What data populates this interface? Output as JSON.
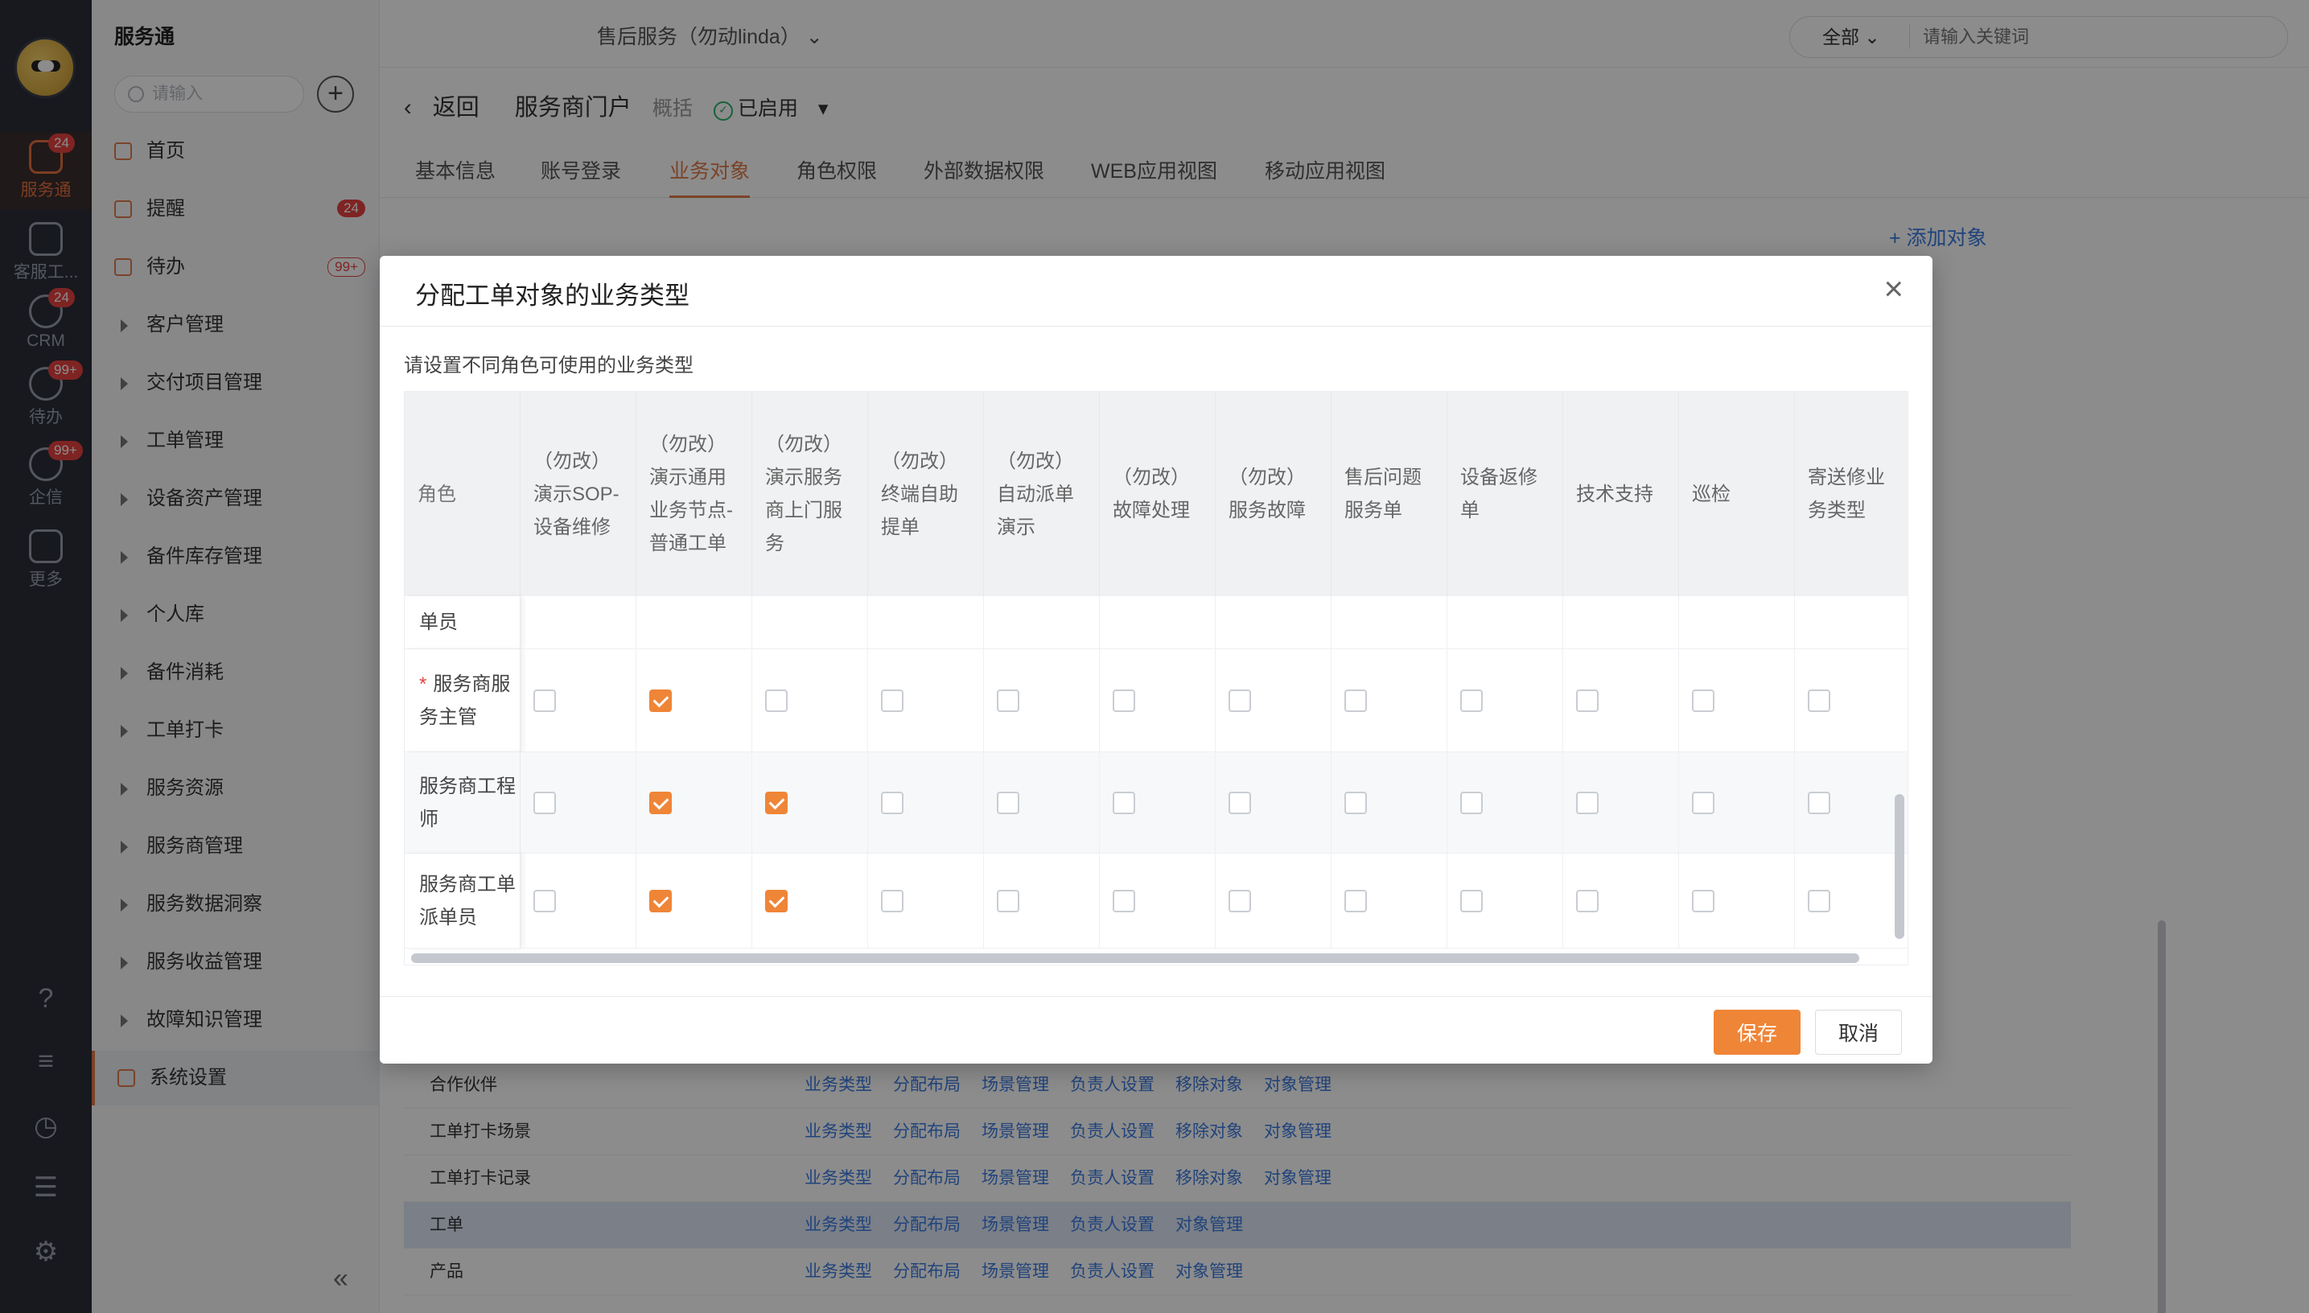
{
  "rail": {
    "items": [
      {
        "label": "服务通",
        "badge": "24"
      },
      {
        "label": "客服工...",
        "badge": ""
      },
      {
        "label": "CRM",
        "badge": "24"
      },
      {
        "label": "待办",
        "badge": "99+"
      },
      {
        "label": "企信",
        "badge": "99+"
      },
      {
        "label": "更多",
        "badge": ""
      }
    ],
    "bottom_icons": [
      "help-icon",
      "notes-icon",
      "clock-icon",
      "user-list-icon",
      "gear-icon"
    ]
  },
  "sidebar": {
    "brand": "服务通",
    "search_placeholder": "请输入",
    "items": [
      {
        "label": "首页",
        "badge": ""
      },
      {
        "label": "提醒",
        "badge": "24"
      },
      {
        "label": "待办",
        "badge": "99+"
      },
      {
        "label": "客户管理",
        "badge": ""
      },
      {
        "label": "交付项目管理",
        "badge": ""
      },
      {
        "label": "工单管理",
        "badge": ""
      },
      {
        "label": "设备资产管理",
        "badge": ""
      },
      {
        "label": "备件库存管理",
        "badge": ""
      },
      {
        "label": "个人库",
        "badge": ""
      },
      {
        "label": "备件消耗",
        "badge": ""
      },
      {
        "label": "工单打卡",
        "badge": ""
      },
      {
        "label": "服务资源",
        "badge": ""
      },
      {
        "label": "服务商管理",
        "badge": ""
      },
      {
        "label": "服务数据洞察",
        "badge": ""
      },
      {
        "label": "服务收益管理",
        "badge": ""
      },
      {
        "label": "故障知识管理",
        "badge": ""
      },
      {
        "label": "系统设置",
        "badge": ""
      }
    ],
    "collapse_label": "«"
  },
  "topbar": {
    "tenant": "售后服务（勿动linda）",
    "search_scope": "全部",
    "search_placeholder": "请输入关键词"
  },
  "page": {
    "back_label": "返回",
    "title": "服务商门户",
    "subtitle": "概括",
    "status": "已启用",
    "tabs": [
      "基本信息",
      "账号登录",
      "业务对象",
      "角色权限",
      "外部数据权限",
      "WEB应用视图",
      "移动应用视图"
    ],
    "active_tab": 2,
    "add_object": "+ 添加对象",
    "bg_rows": [
      {
        "name": "合作伙伴",
        "actions": [
          "业务类型",
          "分配布局",
          "场景管理",
          "负责人设置",
          "移除对象",
          "对象管理"
        ]
      },
      {
        "name": "工单打卡场景",
        "actions": [
          "业务类型",
          "分配布局",
          "场景管理",
          "负责人设置",
          "移除对象",
          "对象管理"
        ]
      },
      {
        "name": "工单打卡记录",
        "actions": [
          "业务类型",
          "分配布局",
          "场景管理",
          "负责人设置",
          "移除对象",
          "对象管理"
        ]
      },
      {
        "name": "工单",
        "actions": [
          "业务类型",
          "分配布局",
          "场景管理",
          "负责人设置",
          "对象管理"
        ]
      },
      {
        "name": "产品",
        "actions": [
          "业务类型",
          "分配布局",
          "场景管理",
          "负责人设置",
          "对象管理"
        ]
      }
    ]
  },
  "modal": {
    "title": "分配工单对象的业务类型",
    "close": "×",
    "description": "请设置不同角色可使用的业务类型",
    "role_header": "角色",
    "columns": [
      "（勿改）演示SOP-设备维修",
      "（勿改）演示通用业务节点-普通工单",
      "（勿改）演示服务商上门服务",
      "（勿改）终端自助提单",
      "（勿改）自动派单演示",
      "（勿改）故障处理",
      "（勿改）服务故障",
      "售后问题服务单",
      "设备返修单",
      "技术支持",
      "巡检",
      "寄送修业务类型"
    ],
    "partial_row_label": "单员",
    "rows": [
      {
        "role": "服务商服务主管",
        "required": true,
        "checks": [
          false,
          true,
          false,
          false,
          false,
          false,
          false,
          false,
          false,
          false,
          false,
          false
        ]
      },
      {
        "role": "服务商工程师",
        "required": false,
        "checks": [
          false,
          true,
          true,
          false,
          false,
          false,
          false,
          false,
          false,
          false,
          false,
          false
        ]
      },
      {
        "role": "服务商工单派单员",
        "required": false,
        "checks": [
          false,
          true,
          true,
          false,
          false,
          false,
          false,
          false,
          false,
          false,
          false,
          false
        ]
      }
    ],
    "required_mark": "*",
    "save_label": "保存",
    "cancel_label": "取消"
  },
  "colors": {
    "accent": "#ef8537",
    "link": "#3b7be0",
    "rail_bg": "#2b2f3a",
    "badge": "#e64340",
    "status_ok": "#29b36b"
  }
}
